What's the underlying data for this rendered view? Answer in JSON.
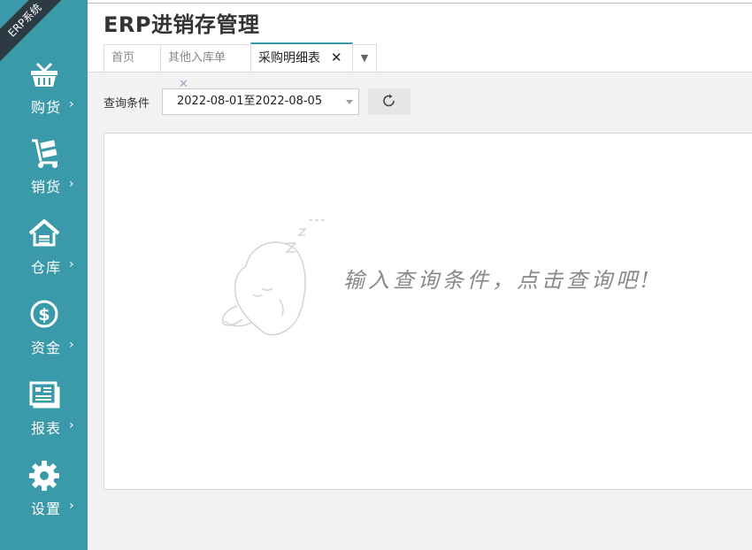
{
  "sidebar": {
    "badge": "ERP系统",
    "items": [
      {
        "label": "购货",
        "icon": "basket-icon"
      },
      {
        "label": "销货",
        "icon": "hand-truck-icon"
      },
      {
        "label": "仓库",
        "icon": "warehouse-icon"
      },
      {
        "label": "资金",
        "icon": "dollar-icon"
      },
      {
        "label": "报表",
        "icon": "report-icon"
      },
      {
        "label": "设置",
        "icon": "gear-icon"
      }
    ],
    "chevron": "›"
  },
  "header": {
    "title": "ERP进销存管理",
    "tabs": [
      {
        "label": "首页",
        "closable": false,
        "active": false
      },
      {
        "label": "其他入库单",
        "closable": true,
        "active": false
      },
      {
        "label": "采购明细表",
        "closable": true,
        "active": true
      }
    ],
    "close_glyph": "✕",
    "more_glyph": "▼"
  },
  "query": {
    "label": "查询条件",
    "date_range": "2022-08-01至2022-08-05"
  },
  "empty": {
    "message": "输入查询条件，点击查询吧!"
  },
  "colors": {
    "accent": "#3a9aaa",
    "corner": "#2c3a44"
  }
}
